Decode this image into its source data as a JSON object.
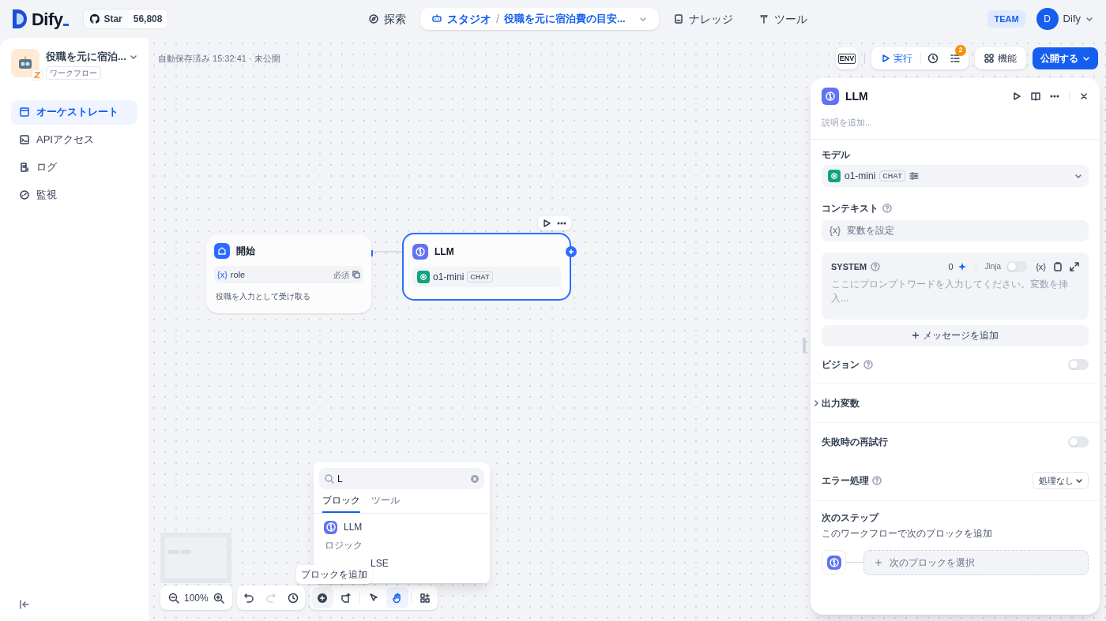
{
  "header": {
    "logo": "Dify",
    "github": {
      "label": "Star",
      "count": "56,808"
    },
    "nav": [
      {
        "label": "探索",
        "selected": false
      },
      {
        "label": "スタジオ",
        "selected": true,
        "separator": "/",
        "breadcrumb": "役職を元に宿泊費の目安..."
      },
      {
        "label": "ナレッジ",
        "selected": false
      },
      {
        "label": "ツール",
        "selected": false
      }
    ],
    "team": "TEAM",
    "user": {
      "initial": "D",
      "name": "Dify"
    }
  },
  "app": {
    "name": "役職を元に宿泊...",
    "type": "ワークフロー"
  },
  "sidebar": {
    "items": [
      {
        "label": "オーケストレート",
        "selected": true
      },
      {
        "label": "APIアクセス",
        "selected": false
      },
      {
        "label": "ログ",
        "selected": false
      },
      {
        "label": "監視",
        "selected": false
      }
    ]
  },
  "canvas": {
    "status": "自動保存済み 15:32:41 · 未公開",
    "toolbar": {
      "env": "ENV",
      "run": "実行",
      "badge": "2",
      "features": "機能",
      "publish": "公開する"
    },
    "start_node": {
      "title": "開始",
      "variable_mark": "{x}",
      "variable": "role",
      "required": "必須",
      "description": "役職を入力として受け取る"
    },
    "llm_node": {
      "title": "LLM",
      "model": "o1-mini",
      "mode": "CHAT",
      "selected": true
    },
    "block_picker": {
      "query": "L",
      "tabs": [
        {
          "label": "ブロック",
          "selected": true
        },
        {
          "label": "ツール",
          "selected": false
        }
      ],
      "items": [
        {
          "kind": "block",
          "label": "LLM"
        },
        {
          "kind": "group",
          "label": "ロジック"
        },
        {
          "kind": "block",
          "label": "LSE"
        }
      ]
    },
    "tooltip": "ブロックを追加",
    "zoom": "100%",
    "tools": [
      {
        "kind": "add",
        "selected": true
      },
      {
        "kind": "note",
        "selected": false
      },
      {
        "kind": "pointer",
        "selected": false
      },
      {
        "kind": "hand",
        "selected": true
      },
      {
        "kind": "layout",
        "selected": false
      }
    ]
  },
  "panel": {
    "title": "LLM",
    "description_placeholder": "説明を追加...",
    "model_label": "モデル",
    "model": "o1-mini",
    "mode": "CHAT",
    "context_label": "コンテキスト",
    "context_mark": "{x}",
    "context_placeholder": "変数を設定",
    "system": {
      "label": "SYSTEM",
      "count": "0",
      "jinja": "Jinja",
      "jinja_on": false,
      "variable_button": "{x}",
      "placeholder": "ここにプロンプトワードを入力してください。変数を挿入..."
    },
    "add_message": "メッセージを追加",
    "vision": {
      "label": "ビジョン",
      "on": false
    },
    "output_label": "出力変数",
    "output_expanded": false,
    "retry": {
      "label": "失敗時の再試行",
      "on": false
    },
    "error": {
      "label": "エラー処理",
      "value": "処理なし"
    },
    "next": {
      "title": "次のステップ",
      "subtitle": "このワークフローで次のブロックを追加",
      "select": "次のブロックを選択"
    }
  }
}
